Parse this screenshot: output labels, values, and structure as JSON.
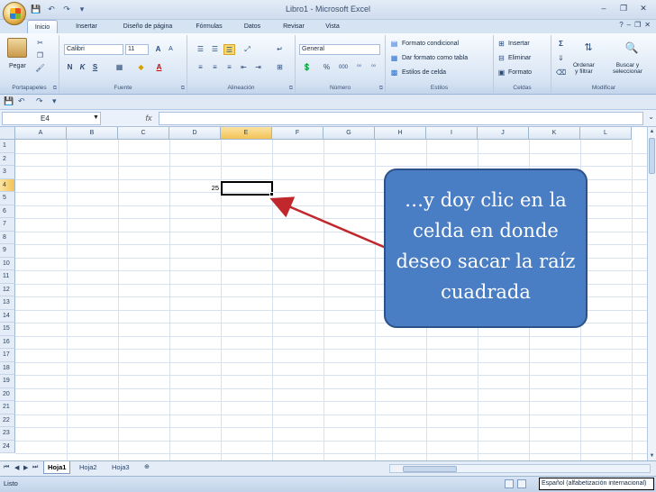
{
  "window": {
    "title": "Libro1 - Microsoft Excel",
    "controls": [
      "–",
      "❐",
      "✕"
    ]
  },
  "quick_access": [
    "💾",
    "↶",
    "↷",
    "▾"
  ],
  "ribbon_tabs": [
    "Inicio",
    "Insertar",
    "Diseño de página",
    "Fórmulas",
    "Datos",
    "Revisar",
    "Vista"
  ],
  "active_tab": "Inicio",
  "ribbon": {
    "groups": {
      "portapapeles": {
        "label": "Portapapeles",
        "paste": "Pegar"
      },
      "fuente": {
        "label": "Fuente",
        "font_name": "Calibri",
        "font_size": "11",
        "bold": "N",
        "italic": "K",
        "underline": "S",
        "grow": "A",
        "shrink": "A",
        "font_color": "A"
      },
      "alineacion": {
        "label": "Alineación"
      },
      "numero": {
        "label": "Número",
        "format": "General",
        "percent": "%",
        "thousands": "000"
      },
      "estilos": {
        "label": "Estilos",
        "conditional": "Formato condicional",
        "as_table": "Dar formato como tabla",
        "cell_styles": "Estilos de celda"
      },
      "celdas": {
        "label": "Celdas",
        "insert": "Insertar",
        "delete": "Eliminar",
        "format": "Formato"
      },
      "modificar": {
        "label": "Modificar",
        "sigma": "Σ",
        "sort": "Ordenar\ny filtrar",
        "find": "Buscar y\nseleccionar"
      }
    }
  },
  "formula_bar": {
    "name_box": "E4",
    "fx": "fx",
    "formula": ""
  },
  "grid": {
    "columns": [
      "A",
      "B",
      "C",
      "D",
      "E",
      "F",
      "G",
      "H",
      "I",
      "J",
      "K",
      "L"
    ],
    "rows": [
      "1",
      "2",
      "3",
      "4",
      "5",
      "6",
      "7",
      "8",
      "9",
      "10",
      "11",
      "12",
      "13",
      "14",
      "15",
      "16",
      "17",
      "18",
      "19",
      "20",
      "21",
      "22",
      "23",
      "24"
    ],
    "selected_column": "E",
    "selected_row": "4",
    "cells": {
      "D4": "25"
    }
  },
  "sheets": [
    "Hoja1",
    "Hoja2",
    "Hoja3"
  ],
  "active_sheet": "Hoja1",
  "status": {
    "text": "Listo",
    "language_tooltip": "Español (alfabetización internacional)"
  },
  "callout": {
    "text": "…y doy clic en la celda en donde deseo sacar la raíz cuadrada",
    "fill_color": "#4a7ec4",
    "arrow_color": "#c0282d"
  }
}
